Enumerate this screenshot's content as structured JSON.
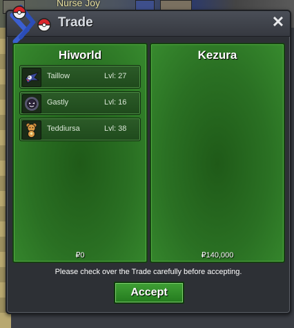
{
  "background": {
    "npc_label": "Nurse Joy"
  },
  "window": {
    "title": "Trade",
    "close_icon": "close-x-icon"
  },
  "players": [
    {
      "name": "Hiworld",
      "money": "₽0",
      "pokemon": [
        {
          "name": "Taillow",
          "level": "Lvl: 27",
          "icon": "taillow-icon"
        },
        {
          "name": "Gastly",
          "level": "Lvl: 16",
          "icon": "gastly-icon"
        },
        {
          "name": "Teddiursa",
          "level": "Lvl: 38",
          "icon": "teddiursa-icon"
        }
      ]
    },
    {
      "name": "Kezura",
      "money": "₽140,000",
      "pokemon": []
    }
  ],
  "notice": "Please check over the Trade carefully before accepting.",
  "accept_label": "Accept",
  "colors": {
    "panel_green": "#2a7023",
    "accept_green": "#3fa035",
    "window_dark": "#2d3035"
  }
}
